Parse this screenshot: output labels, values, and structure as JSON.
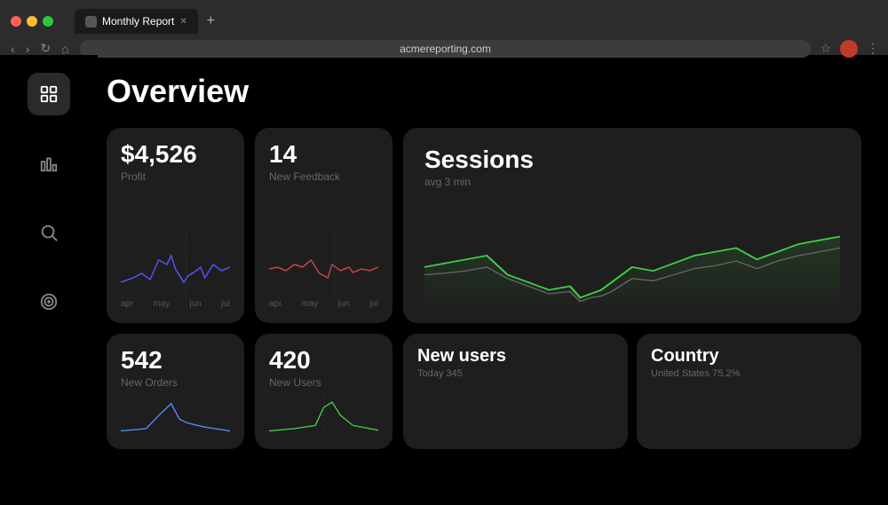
{
  "browser": {
    "tab_label": "Monthly Report",
    "new_tab_symbol": "+",
    "url": "acmereporting.com",
    "back": "‹",
    "forward": "›",
    "reload": "↻",
    "home": "⌂",
    "star": "☆",
    "menu": "⋮",
    "profile_initials": ""
  },
  "sidebar": {
    "items": [
      {
        "name": "grid",
        "label": "Dashboard",
        "active": true
      },
      {
        "name": "chart",
        "label": "Analytics",
        "active": false
      },
      {
        "name": "search",
        "label": "Search",
        "active": false
      },
      {
        "name": "target",
        "label": "Goals",
        "active": false
      }
    ]
  },
  "page": {
    "title": "Overview"
  },
  "cards": {
    "profit": {
      "value": "$4,526",
      "label": "Profit",
      "chart_labels": [
        "apr",
        "may",
        "jun",
        "jul"
      ],
      "color": "#5555ff"
    },
    "feedback": {
      "value": "14",
      "label": "New Feedback",
      "chart_labels": [
        "apr",
        "may",
        "jun",
        "jul"
      ],
      "color": "#cc4444"
    },
    "sessions": {
      "title": "Sessions",
      "subtitle": "avg 3 min",
      "color_main": "#44cc44",
      "color_secondary": "#555"
    },
    "new_orders": {
      "value": "542",
      "label": "New Orders",
      "color": "#5588ff"
    },
    "new_users_card": {
      "value": "420",
      "label": "New Users",
      "color": "#44cc44"
    },
    "new_users_stat": {
      "title": "New users",
      "sub": "Today 345"
    },
    "country": {
      "title": "Country",
      "sub": "United States 75.2%"
    }
  }
}
